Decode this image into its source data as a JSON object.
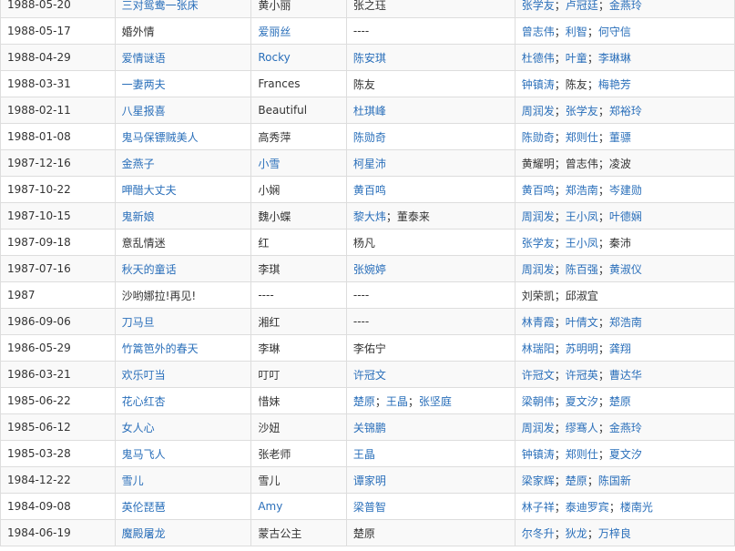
{
  "colors": {
    "link": "#2a6fba",
    "text": "#333333",
    "border": "#dddddd",
    "row_alt": "#f9f9f9"
  },
  "rows": [
    {
      "date": "1988-05-20",
      "title": {
        "text": "三对鸳鸯一张床",
        "link": true
      },
      "role": {
        "text": "黄小丽",
        "link": false
      },
      "director": [
        {
          "text": "张之珏",
          "link": false
        }
      ],
      "cast": [
        {
          "text": "张学友",
          "link": true
        },
        {
          "text": "卢冠廷",
          "link": true
        },
        {
          "text": "金燕玲",
          "link": true
        }
      ]
    },
    {
      "date": "1988-05-17",
      "title": {
        "text": "婚外情",
        "link": false
      },
      "role": {
        "text": "爱丽丝",
        "link": true
      },
      "director": [
        {
          "text": "----",
          "link": false
        }
      ],
      "cast": [
        {
          "text": "曾志伟",
          "link": true
        },
        {
          "text": "利智",
          "link": true
        },
        {
          "text": "何守信",
          "link": true
        }
      ]
    },
    {
      "date": "1988-04-29",
      "title": {
        "text": "爱情谜语",
        "link": true
      },
      "role": {
        "text": "Rocky",
        "link": true
      },
      "director": [
        {
          "text": "陈安琪",
          "link": true
        }
      ],
      "cast": [
        {
          "text": "杜德伟",
          "link": true
        },
        {
          "text": "叶童",
          "link": true
        },
        {
          "text": "李琳琳",
          "link": true
        }
      ]
    },
    {
      "date": "1988-03-31",
      "title": {
        "text": "一妻两夫",
        "link": true
      },
      "role": {
        "text": "Frances",
        "link": false
      },
      "director": [
        {
          "text": "陈友",
          "link": false
        }
      ],
      "cast": [
        {
          "text": "钟镇涛",
          "link": true
        },
        {
          "text": "陈友",
          "link": false
        },
        {
          "text": "梅艳芳",
          "link": true
        }
      ]
    },
    {
      "date": "1988-02-11",
      "title": {
        "text": "八星报喜",
        "link": true
      },
      "role": {
        "text": "Beautiful",
        "link": false
      },
      "director": [
        {
          "text": "杜琪峰",
          "link": true
        }
      ],
      "cast": [
        {
          "text": "周润发",
          "link": true
        },
        {
          "text": "张学友",
          "link": true
        },
        {
          "text": "郑裕玲",
          "link": true
        }
      ]
    },
    {
      "date": "1988-01-08",
      "title": {
        "text": "鬼马保镖贼美人",
        "link": true
      },
      "role": {
        "text": "高秀萍",
        "link": false
      },
      "director": [
        {
          "text": "陈勋奇",
          "link": true
        }
      ],
      "cast": [
        {
          "text": "陈勋奇",
          "link": true
        },
        {
          "text": "郑则仕",
          "link": true
        },
        {
          "text": "董骠",
          "link": true
        }
      ]
    },
    {
      "date": "1987-12-16",
      "title": {
        "text": "金燕子",
        "link": true
      },
      "role": {
        "text": "小雪",
        "link": true
      },
      "director": [
        {
          "text": "柯星沛",
          "link": true
        }
      ],
      "cast": [
        {
          "text": "黄耀明",
          "link": false
        },
        {
          "text": "曾志伟",
          "link": false
        },
        {
          "text": "凌波",
          "link": false
        }
      ]
    },
    {
      "date": "1987-10-22",
      "title": {
        "text": "呷醋大丈夫",
        "link": true
      },
      "role": {
        "text": "小娴",
        "link": false
      },
      "director": [
        {
          "text": "黄百鸣",
          "link": true
        }
      ],
      "cast": [
        {
          "text": "黄百鸣",
          "link": true
        },
        {
          "text": "郑浩南",
          "link": true
        },
        {
          "text": "岑建勋",
          "link": true
        }
      ]
    },
    {
      "date": "1987-10-15",
      "title": {
        "text": "鬼新娘",
        "link": true
      },
      "role": {
        "text": "魏小蝶",
        "link": false
      },
      "director": [
        {
          "text": "黎大炜",
          "link": true
        },
        {
          "text": "董泰来",
          "link": false
        }
      ],
      "cast": [
        {
          "text": "周润发",
          "link": true
        },
        {
          "text": "王小凤",
          "link": true
        },
        {
          "text": "叶德娴",
          "link": true
        }
      ]
    },
    {
      "date": "1987-09-18",
      "title": {
        "text": "意乱情迷",
        "link": false
      },
      "role": {
        "text": "红",
        "link": false
      },
      "director": [
        {
          "text": "杨凡",
          "link": false
        }
      ],
      "cast": [
        {
          "text": "张学友",
          "link": true
        },
        {
          "text": "王小凤",
          "link": true
        },
        {
          "text": "秦沛",
          "link": false
        }
      ]
    },
    {
      "date": "1987-07-16",
      "title": {
        "text": "秋天的童话",
        "link": true
      },
      "role": {
        "text": "李琪",
        "link": false
      },
      "director": [
        {
          "text": "张婉婷",
          "link": true
        }
      ],
      "cast": [
        {
          "text": "周润发",
          "link": true
        },
        {
          "text": "陈百强",
          "link": true
        },
        {
          "text": "黄淑仪",
          "link": true
        }
      ]
    },
    {
      "date": "1987",
      "title": {
        "text": "沙哟娜拉!再见!",
        "link": false
      },
      "role": {
        "text": "----",
        "link": false
      },
      "director": [
        {
          "text": "----",
          "link": false
        }
      ],
      "cast": [
        {
          "text": "刘荣凯",
          "link": false
        },
        {
          "text": "邱淑宜",
          "link": false
        }
      ]
    },
    {
      "date": "1986-09-06",
      "title": {
        "text": "刀马旦",
        "link": true
      },
      "role": {
        "text": "湘红",
        "link": false
      },
      "director": [
        {
          "text": "----",
          "link": false
        }
      ],
      "cast": [
        {
          "text": "林青霞",
          "link": true
        },
        {
          "text": "叶倩文",
          "link": true
        },
        {
          "text": "郑浩南",
          "link": true
        }
      ]
    },
    {
      "date": "1986-05-29",
      "title": {
        "text": "竹篙笆外的春天",
        "link": true
      },
      "role": {
        "text": "李琳",
        "link": false
      },
      "director": [
        {
          "text": "李佑宁",
          "link": false
        }
      ],
      "cast": [
        {
          "text": "林瑞阳",
          "link": true
        },
        {
          "text": "苏明明",
          "link": true
        },
        {
          "text": "龚翔",
          "link": true
        }
      ]
    },
    {
      "date": "1986-03-21",
      "title": {
        "text": "欢乐叮当",
        "link": true
      },
      "role": {
        "text": "叮叮",
        "link": false
      },
      "director": [
        {
          "text": "许冠文",
          "link": true
        }
      ],
      "cast": [
        {
          "text": "许冠文",
          "link": true
        },
        {
          "text": "许冠英",
          "link": true
        },
        {
          "text": "曹达华",
          "link": true
        }
      ]
    },
    {
      "date": "1985-06-22",
      "title": {
        "text": "花心红杏",
        "link": true
      },
      "role": {
        "text": "惜妹",
        "link": false
      },
      "director": [
        {
          "text": "楚原",
          "link": true
        },
        {
          "text": "王晶",
          "link": true
        },
        {
          "text": "张坚庭",
          "link": true
        }
      ],
      "cast": [
        {
          "text": "梁朝伟",
          "link": true
        },
        {
          "text": "夏文汐",
          "link": true
        },
        {
          "text": "楚原",
          "link": true
        }
      ]
    },
    {
      "date": "1985-06-12",
      "title": {
        "text": "女人心",
        "link": true
      },
      "role": {
        "text": "沙妞",
        "link": false
      },
      "director": [
        {
          "text": "关锦鹏",
          "link": true
        }
      ],
      "cast": [
        {
          "text": "周润发",
          "link": true
        },
        {
          "text": "缪骞人",
          "link": true
        },
        {
          "text": "金燕玲",
          "link": true
        }
      ]
    },
    {
      "date": "1985-03-28",
      "title": {
        "text": "鬼马飞人",
        "link": true
      },
      "role": {
        "text": "张老师",
        "link": false
      },
      "director": [
        {
          "text": "王晶",
          "link": true
        }
      ],
      "cast": [
        {
          "text": "钟镇涛",
          "link": true
        },
        {
          "text": "郑则仕",
          "link": true
        },
        {
          "text": "夏文汐",
          "link": true
        }
      ]
    },
    {
      "date": "1984-12-22",
      "title": {
        "text": "雪儿",
        "link": true
      },
      "role": {
        "text": "雪儿",
        "link": false
      },
      "director": [
        {
          "text": "谭家明",
          "link": true
        }
      ],
      "cast": [
        {
          "text": "梁家辉",
          "link": true
        },
        {
          "text": "楚原",
          "link": true
        },
        {
          "text": "陈国新",
          "link": true
        }
      ]
    },
    {
      "date": "1984-09-08",
      "title": {
        "text": "英伦琵琶",
        "link": true
      },
      "role": {
        "text": "Amy",
        "link": true
      },
      "director": [
        {
          "text": "梁普智",
          "link": true
        }
      ],
      "cast": [
        {
          "text": "林子祥",
          "link": true
        },
        {
          "text": "泰迪罗宾",
          "link": true
        },
        {
          "text": "楼南光",
          "link": true
        }
      ]
    },
    {
      "date": "1984-06-19",
      "title": {
        "text": "魔殿屠龙",
        "link": true
      },
      "role": {
        "text": "蒙古公主",
        "link": false
      },
      "director": [
        {
          "text": "楚原",
          "link": false
        }
      ],
      "cast": [
        {
          "text": "尔冬升",
          "link": true
        },
        {
          "text": "狄龙",
          "link": true
        },
        {
          "text": "万梓良",
          "link": true
        }
      ]
    }
  ]
}
